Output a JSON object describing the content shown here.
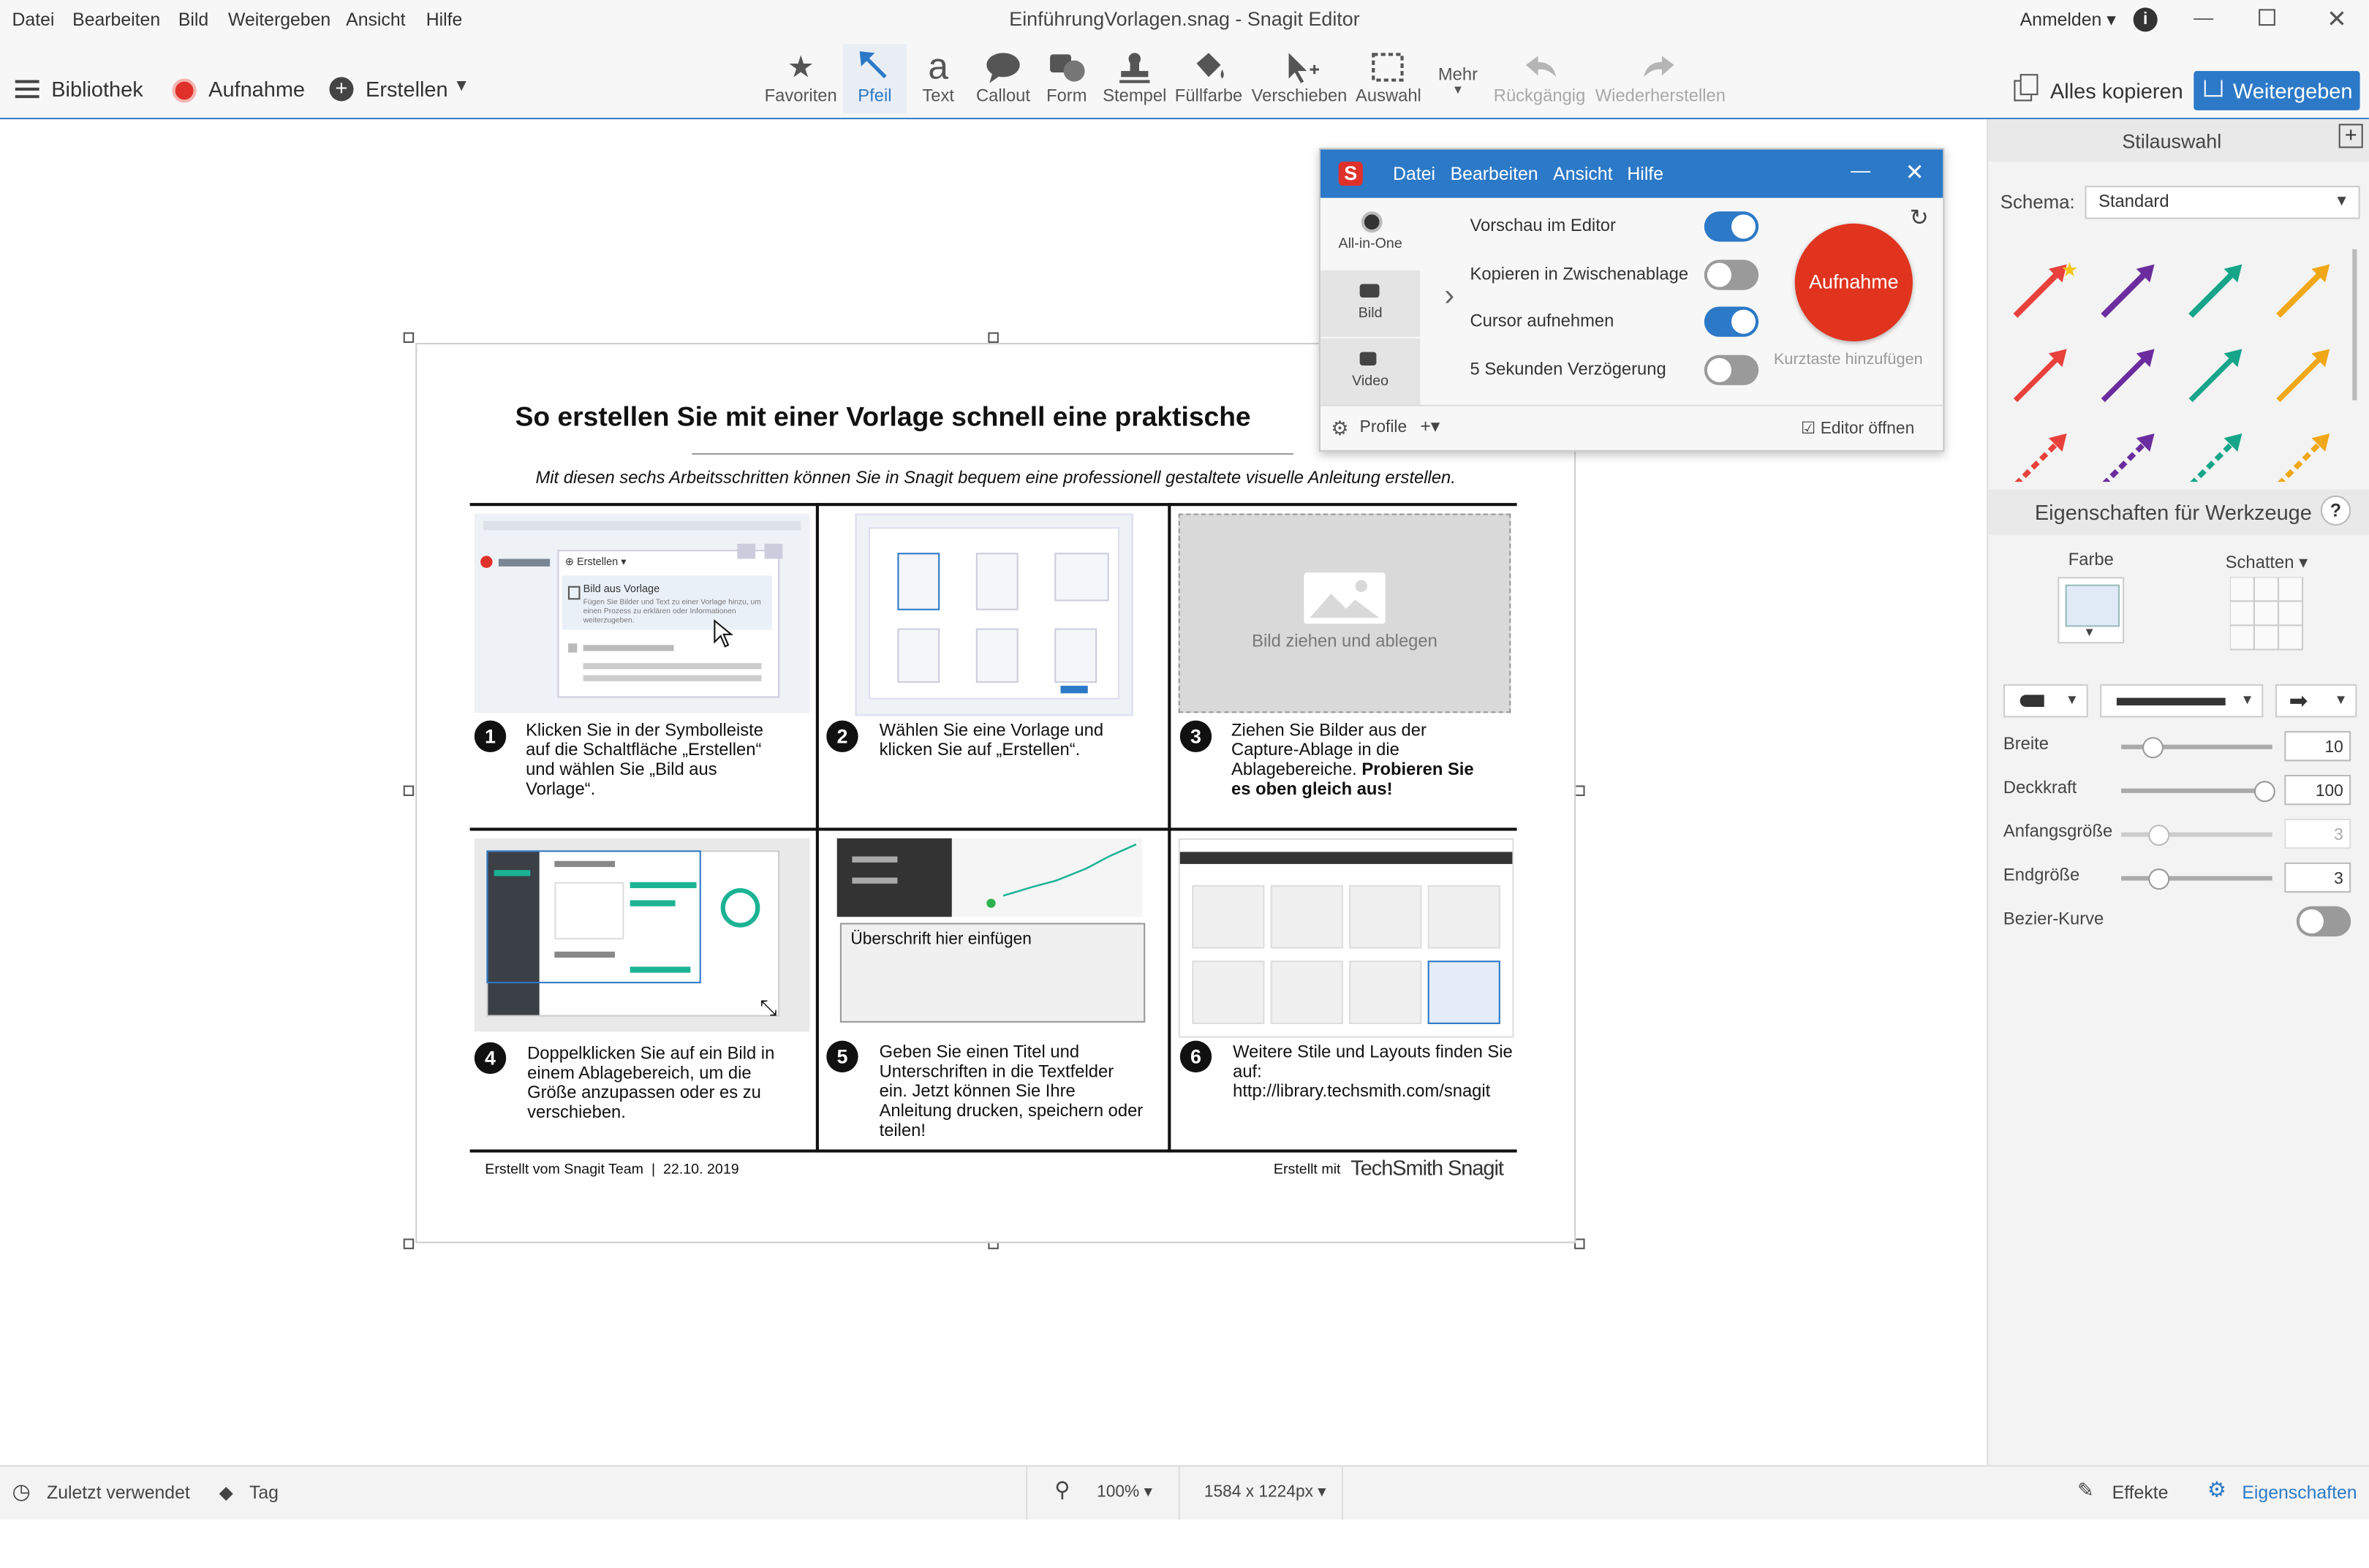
{
  "window": {
    "title": "EinführungVorlagen.snag - Snagit Editor",
    "sign_in": "Anmelden"
  },
  "menu": [
    "Datei",
    "Bearbeiten",
    "Bild",
    "Weitergeben",
    "Ansicht",
    "Hilfe"
  ],
  "toolbar_left": {
    "library": "Bibliothek",
    "capture": "Aufnahme",
    "create": "Erstellen"
  },
  "tools": [
    {
      "label": "Favoriten",
      "icon": "star-icon"
    },
    {
      "label": "Pfeil",
      "icon": "arrow-icon"
    },
    {
      "label": "Text",
      "icon": "text-icon"
    },
    {
      "label": "Callout",
      "icon": "callout-icon"
    },
    {
      "label": "Form",
      "icon": "shape-icon"
    },
    {
      "label": "Stempel",
      "icon": "stamp-icon"
    },
    {
      "label": "Füllfarbe",
      "icon": "fill-icon"
    },
    {
      "label": "Verschieben",
      "icon": "move-icon"
    },
    {
      "label": "Auswahl",
      "icon": "selection-icon"
    },
    {
      "label": "Mehr",
      "icon": "more-icon"
    },
    {
      "label": "Rückgängig",
      "icon": "undo-icon"
    },
    {
      "label": "Wiederherstellen",
      "icon": "redo-icon"
    }
  ],
  "toolbar_right": {
    "copy_all": "Alles kopieren",
    "share": "Weitergeben"
  },
  "document": {
    "heading": "So erstellen Sie mit einer Vorlage schnell eine praktische",
    "subtitle": "Mit diesen sechs Arbeitsschritten können Sie in Snagit bequem eine professionell gestaltete visuelle Anleitung erstellen.",
    "steps": [
      {
        "num": "1",
        "text": "Klicken Sie in der Symbolleiste auf die Schaltfläche „Erstellen“ und wählen Sie „Bild aus Vorlage“."
      },
      {
        "num": "2",
        "text": "Wählen Sie eine Vorlage und klicken Sie auf „Erstellen“."
      },
      {
        "num": "3",
        "text": "Ziehen Sie Bilder aus der Capture-Ablage in die Ablagebereiche.",
        "bold": "Probieren Sie es oben gleich aus!"
      },
      {
        "num": "4",
        "text": "Doppelklicken Sie auf ein Bild in einem Ablagebereich, um die Größe anzupassen oder es zu verschieben."
      },
      {
        "num": "5",
        "text": "Geben Sie einen Titel und Unterschriften in die Textfelder ein. Jetzt können Sie Ihre Anleitung drucken, speichern oder teilen!"
      },
      {
        "num": "6",
        "text": "Weitere Stile und Layouts finden Sie auf: http://library.techsmith.com/snagit"
      }
    ],
    "shot1": {
      "create": "Erstellen",
      "item": "Bild aus Vorlage",
      "desc": "Fügen Sie Bilder und Text zu einer Vorlage hinzu, um einen Prozess zu erklären oder Informationen weiterzugeben."
    },
    "dropzone": "Bild ziehen und ablegen",
    "headline_placeholder": "Überschrift hier einfügen",
    "footer_left": "Erstellt vom Snagit Team",
    "footer_date": "22.10. 2019",
    "footer_made": "Erstellt mit",
    "footer_brand": "TechSmith Snagit"
  },
  "capture_window": {
    "menu": [
      "Datei",
      "Bearbeiten",
      "Ansicht",
      "Hilfe"
    ],
    "modes": [
      "All-in-One",
      "Bild",
      "Video"
    ],
    "options": [
      {
        "label": "Vorschau im Editor",
        "on": true
      },
      {
        "label": "Kopieren in Zwischenablage",
        "on": false
      },
      {
        "label": "Cursor aufnehmen",
        "on": true
      },
      {
        "label": "5 Sekunden Verzögerung",
        "on": false
      }
    ],
    "capture_button": "Aufnahme",
    "shortcut": "Kurztaste hinzufügen",
    "profiles": "Profile",
    "open_editor": "Editor öffnen"
  },
  "panel": {
    "styles_title": "Stilauswahl",
    "schema_label": "Schema:",
    "schema_value": "Standard",
    "arrow_colors": [
      "#e8413c",
      "#6b2d9e",
      "#17a589",
      "#f0a818"
    ],
    "props_title": "Eigenschaften für Werkzeuge",
    "color_label": "Farbe",
    "shadow_label": "Schatten",
    "width_label": "Breite",
    "width_value": "10",
    "opacity_label": "Deckkraft",
    "opacity_value": "100",
    "start_label": "Anfangsgröße",
    "start_value": "3",
    "end_label": "Endgröße",
    "end_value": "3",
    "bezier_label": "Bezier-Kurve"
  },
  "status": {
    "recent": "Zuletzt verwendet",
    "tag": "Tag",
    "zoom": "100%",
    "size": "1584 x 1224px",
    "effects": "Effekte",
    "properties": "Eigenschaften"
  }
}
